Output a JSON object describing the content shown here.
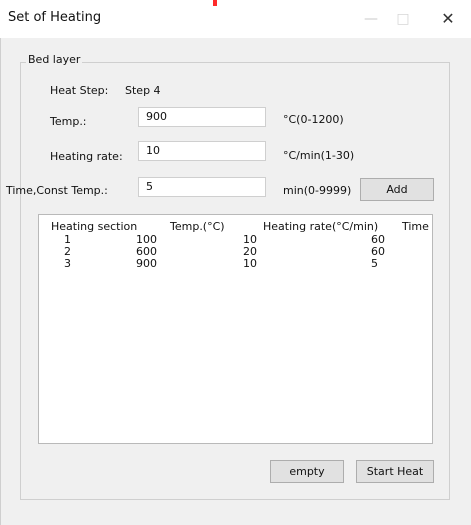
{
  "window": {
    "title": "Set of Heating",
    "minimize_icon": "—",
    "maximize_icon": "□",
    "close_icon": "✕"
  },
  "group": {
    "label": "Bed layer"
  },
  "heat_step": {
    "label": "Heat Step:",
    "value": "Step 4"
  },
  "temp": {
    "label": "Temp.:",
    "value": "900",
    "range": "°C(0-1200)"
  },
  "heating_rate": {
    "label": "Heating rate:",
    "value": "10",
    "range": "°C/min(1-30)"
  },
  "time_const": {
    "label": "Time,Const Temp.:",
    "value": "5",
    "range": "min(0-9999)",
    "add_button": "Add"
  },
  "table": {
    "headers": [
      "Heating section",
      "Temp.(°C)",
      "Heating rate(°C/min)",
      "Time"
    ],
    "rows": [
      [
        "1",
        "100",
        "10",
        "60"
      ],
      [
        "2",
        "600",
        "20",
        "60"
      ],
      [
        "3",
        "900",
        "10",
        "5"
      ]
    ]
  },
  "buttons": {
    "empty": "empty",
    "start_heat": "Start Heat"
  }
}
